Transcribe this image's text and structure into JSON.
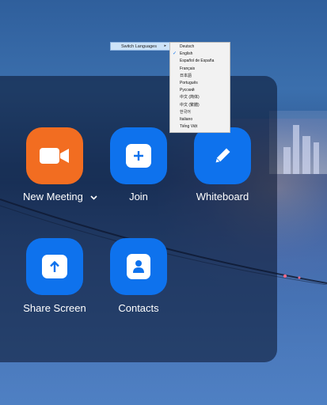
{
  "tiles": [
    {
      "label": "New Meeting",
      "icon": "video-camera-icon",
      "color": "#f26d21"
    },
    {
      "label": "Join",
      "icon": "plus-icon",
      "color": "#0e72ed"
    },
    {
      "label": "Whiteboard",
      "icon": "pencil-icon",
      "color": "#0e72ed"
    },
    {
      "label": "Share Screen",
      "icon": "upload-arrow-icon",
      "color": "#0e72ed"
    },
    {
      "label": "Contacts",
      "icon": "person-icon",
      "color": "#0e72ed"
    }
  ],
  "context_menu": {
    "parent_label": "Switch Languages",
    "languages": [
      {
        "label": "Deutsch",
        "checked": false
      },
      {
        "label": "English",
        "checked": true
      },
      {
        "label": "Español de España",
        "checked": false
      },
      {
        "label": "Français",
        "checked": false
      },
      {
        "label": "日本語",
        "checked": false
      },
      {
        "label": "Português",
        "checked": false
      },
      {
        "label": "Русский",
        "checked": false
      },
      {
        "label": "中文 (简体)",
        "checked": false
      },
      {
        "label": "中文 (繁體)",
        "checked": false
      },
      {
        "label": "한국어",
        "checked": false
      },
      {
        "label": "Italiano",
        "checked": false
      },
      {
        "label": "Tiếng Việt",
        "checked": false
      }
    ]
  }
}
